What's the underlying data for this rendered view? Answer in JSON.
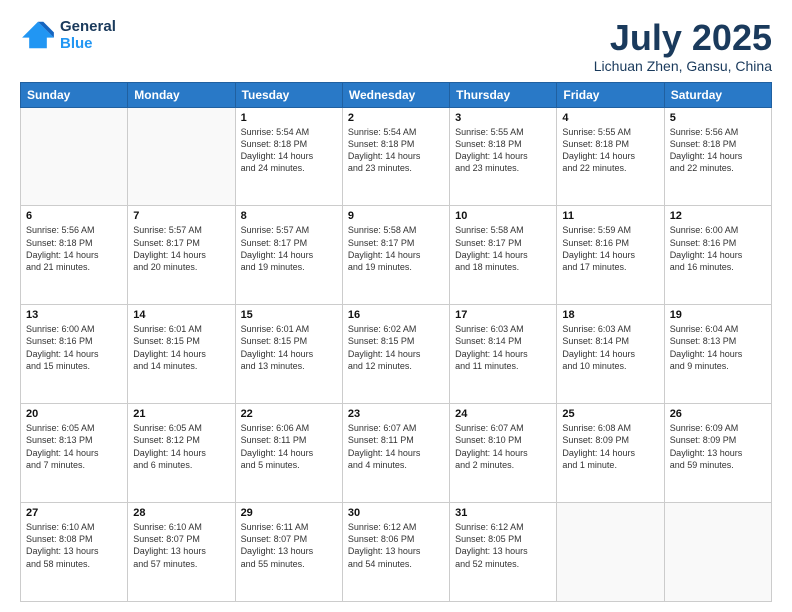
{
  "header": {
    "logo_line1": "General",
    "logo_line2": "Blue",
    "month": "July 2025",
    "location": "Lichuan Zhen, Gansu, China"
  },
  "days_of_week": [
    "Sunday",
    "Monday",
    "Tuesday",
    "Wednesday",
    "Thursday",
    "Friday",
    "Saturday"
  ],
  "weeks": [
    [
      {
        "day": "",
        "text": ""
      },
      {
        "day": "",
        "text": ""
      },
      {
        "day": "1",
        "text": "Sunrise: 5:54 AM\nSunset: 8:18 PM\nDaylight: 14 hours\nand 24 minutes."
      },
      {
        "day": "2",
        "text": "Sunrise: 5:54 AM\nSunset: 8:18 PM\nDaylight: 14 hours\nand 23 minutes."
      },
      {
        "day": "3",
        "text": "Sunrise: 5:55 AM\nSunset: 8:18 PM\nDaylight: 14 hours\nand 23 minutes."
      },
      {
        "day": "4",
        "text": "Sunrise: 5:55 AM\nSunset: 8:18 PM\nDaylight: 14 hours\nand 22 minutes."
      },
      {
        "day": "5",
        "text": "Sunrise: 5:56 AM\nSunset: 8:18 PM\nDaylight: 14 hours\nand 22 minutes."
      }
    ],
    [
      {
        "day": "6",
        "text": "Sunrise: 5:56 AM\nSunset: 8:18 PM\nDaylight: 14 hours\nand 21 minutes."
      },
      {
        "day": "7",
        "text": "Sunrise: 5:57 AM\nSunset: 8:17 PM\nDaylight: 14 hours\nand 20 minutes."
      },
      {
        "day": "8",
        "text": "Sunrise: 5:57 AM\nSunset: 8:17 PM\nDaylight: 14 hours\nand 19 minutes."
      },
      {
        "day": "9",
        "text": "Sunrise: 5:58 AM\nSunset: 8:17 PM\nDaylight: 14 hours\nand 19 minutes."
      },
      {
        "day": "10",
        "text": "Sunrise: 5:58 AM\nSunset: 8:17 PM\nDaylight: 14 hours\nand 18 minutes."
      },
      {
        "day": "11",
        "text": "Sunrise: 5:59 AM\nSunset: 8:16 PM\nDaylight: 14 hours\nand 17 minutes."
      },
      {
        "day": "12",
        "text": "Sunrise: 6:00 AM\nSunset: 8:16 PM\nDaylight: 14 hours\nand 16 minutes."
      }
    ],
    [
      {
        "day": "13",
        "text": "Sunrise: 6:00 AM\nSunset: 8:16 PM\nDaylight: 14 hours\nand 15 minutes."
      },
      {
        "day": "14",
        "text": "Sunrise: 6:01 AM\nSunset: 8:15 PM\nDaylight: 14 hours\nand 14 minutes."
      },
      {
        "day": "15",
        "text": "Sunrise: 6:01 AM\nSunset: 8:15 PM\nDaylight: 14 hours\nand 13 minutes."
      },
      {
        "day": "16",
        "text": "Sunrise: 6:02 AM\nSunset: 8:15 PM\nDaylight: 14 hours\nand 12 minutes."
      },
      {
        "day": "17",
        "text": "Sunrise: 6:03 AM\nSunset: 8:14 PM\nDaylight: 14 hours\nand 11 minutes."
      },
      {
        "day": "18",
        "text": "Sunrise: 6:03 AM\nSunset: 8:14 PM\nDaylight: 14 hours\nand 10 minutes."
      },
      {
        "day": "19",
        "text": "Sunrise: 6:04 AM\nSunset: 8:13 PM\nDaylight: 14 hours\nand 9 minutes."
      }
    ],
    [
      {
        "day": "20",
        "text": "Sunrise: 6:05 AM\nSunset: 8:13 PM\nDaylight: 14 hours\nand 7 minutes."
      },
      {
        "day": "21",
        "text": "Sunrise: 6:05 AM\nSunset: 8:12 PM\nDaylight: 14 hours\nand 6 minutes."
      },
      {
        "day": "22",
        "text": "Sunrise: 6:06 AM\nSunset: 8:11 PM\nDaylight: 14 hours\nand 5 minutes."
      },
      {
        "day": "23",
        "text": "Sunrise: 6:07 AM\nSunset: 8:11 PM\nDaylight: 14 hours\nand 4 minutes."
      },
      {
        "day": "24",
        "text": "Sunrise: 6:07 AM\nSunset: 8:10 PM\nDaylight: 14 hours\nand 2 minutes."
      },
      {
        "day": "25",
        "text": "Sunrise: 6:08 AM\nSunset: 8:09 PM\nDaylight: 14 hours\nand 1 minute."
      },
      {
        "day": "26",
        "text": "Sunrise: 6:09 AM\nSunset: 8:09 PM\nDaylight: 13 hours\nand 59 minutes."
      }
    ],
    [
      {
        "day": "27",
        "text": "Sunrise: 6:10 AM\nSunset: 8:08 PM\nDaylight: 13 hours\nand 58 minutes."
      },
      {
        "day": "28",
        "text": "Sunrise: 6:10 AM\nSunset: 8:07 PM\nDaylight: 13 hours\nand 57 minutes."
      },
      {
        "day": "29",
        "text": "Sunrise: 6:11 AM\nSunset: 8:07 PM\nDaylight: 13 hours\nand 55 minutes."
      },
      {
        "day": "30",
        "text": "Sunrise: 6:12 AM\nSunset: 8:06 PM\nDaylight: 13 hours\nand 54 minutes."
      },
      {
        "day": "31",
        "text": "Sunrise: 6:12 AM\nSunset: 8:05 PM\nDaylight: 13 hours\nand 52 minutes."
      },
      {
        "day": "",
        "text": ""
      },
      {
        "day": "",
        "text": ""
      }
    ]
  ]
}
